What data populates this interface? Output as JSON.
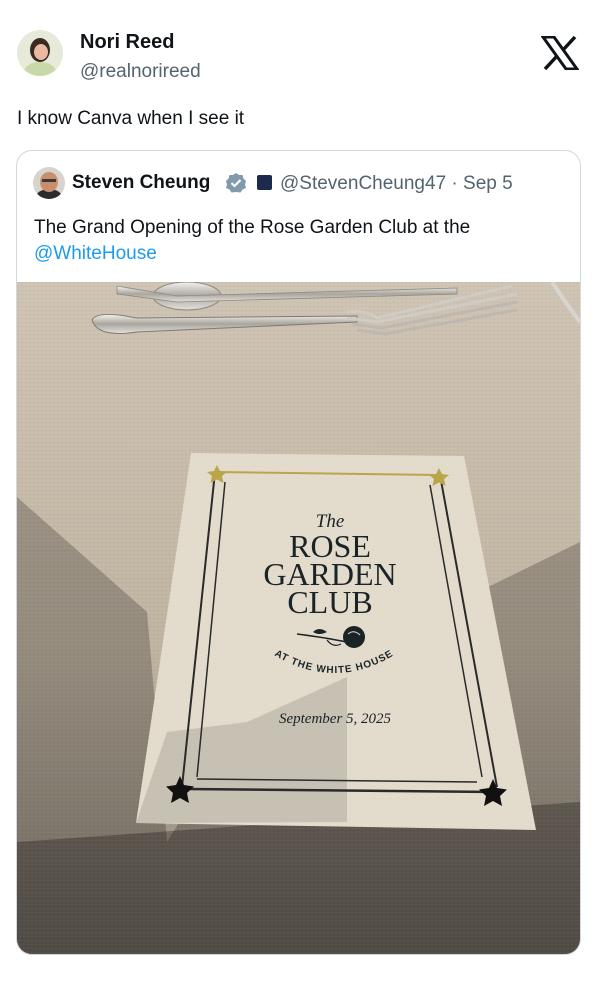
{
  "author": {
    "name": "Nori Reed",
    "handle": "@realnorireed"
  },
  "tweet": {
    "text": "I know Canva when I see it"
  },
  "quote": {
    "author_name": "Steven Cheung",
    "handle": "@StevenCheung47",
    "separator": "·",
    "date": "Sep 5",
    "text": "The Grand Opening of the Rose Garden Club at the",
    "mention": "@WhiteHouse"
  },
  "photo_card": {
    "line_the": "The",
    "line_rose": "ROSE",
    "line_garden": "GARDEN",
    "line_club": "CLUB",
    "arc_text": "AT THE WHITE HOUSE",
    "date": "September 5, 2025"
  },
  "colors": {
    "text": "#0f1419",
    "secondary": "#536471",
    "link": "#1d9bf0",
    "verified": "#829aab",
    "gold": "#a99b44"
  },
  "icons": [
    "x-logo-icon",
    "verified-badge-icon",
    "affiliation-badge-icon"
  ]
}
